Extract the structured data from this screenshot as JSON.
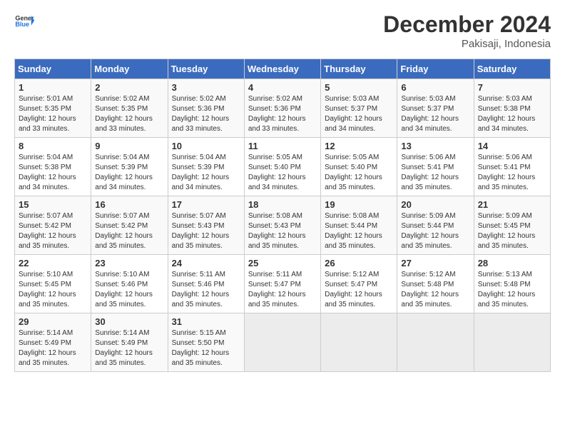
{
  "header": {
    "logo_line1": "General",
    "logo_line2": "Blue",
    "month_title": "December 2024",
    "location": "Pakisaji, Indonesia"
  },
  "days_of_week": [
    "Sunday",
    "Monday",
    "Tuesday",
    "Wednesday",
    "Thursday",
    "Friday",
    "Saturday"
  ],
  "weeks": [
    [
      {
        "num": "1",
        "rise": "5:01 AM",
        "set": "5:35 PM",
        "daylight": "12 hours and 33 minutes."
      },
      {
        "num": "2",
        "rise": "5:02 AM",
        "set": "5:35 PM",
        "daylight": "12 hours and 33 minutes."
      },
      {
        "num": "3",
        "rise": "5:02 AM",
        "set": "5:36 PM",
        "daylight": "12 hours and 33 minutes."
      },
      {
        "num": "4",
        "rise": "5:02 AM",
        "set": "5:36 PM",
        "daylight": "12 hours and 33 minutes."
      },
      {
        "num": "5",
        "rise": "5:03 AM",
        "set": "5:37 PM",
        "daylight": "12 hours and 34 minutes."
      },
      {
        "num": "6",
        "rise": "5:03 AM",
        "set": "5:37 PM",
        "daylight": "12 hours and 34 minutes."
      },
      {
        "num": "7",
        "rise": "5:03 AM",
        "set": "5:38 PM",
        "daylight": "12 hours and 34 minutes."
      }
    ],
    [
      {
        "num": "8",
        "rise": "5:04 AM",
        "set": "5:38 PM",
        "daylight": "12 hours and 34 minutes."
      },
      {
        "num": "9",
        "rise": "5:04 AM",
        "set": "5:39 PM",
        "daylight": "12 hours and 34 minutes."
      },
      {
        "num": "10",
        "rise": "5:04 AM",
        "set": "5:39 PM",
        "daylight": "12 hours and 34 minutes."
      },
      {
        "num": "11",
        "rise": "5:05 AM",
        "set": "5:40 PM",
        "daylight": "12 hours and 34 minutes."
      },
      {
        "num": "12",
        "rise": "5:05 AM",
        "set": "5:40 PM",
        "daylight": "12 hours and 35 minutes."
      },
      {
        "num": "13",
        "rise": "5:06 AM",
        "set": "5:41 PM",
        "daylight": "12 hours and 35 minutes."
      },
      {
        "num": "14",
        "rise": "5:06 AM",
        "set": "5:41 PM",
        "daylight": "12 hours and 35 minutes."
      }
    ],
    [
      {
        "num": "15",
        "rise": "5:07 AM",
        "set": "5:42 PM",
        "daylight": "12 hours and 35 minutes."
      },
      {
        "num": "16",
        "rise": "5:07 AM",
        "set": "5:42 PM",
        "daylight": "12 hours and 35 minutes."
      },
      {
        "num": "17",
        "rise": "5:07 AM",
        "set": "5:43 PM",
        "daylight": "12 hours and 35 minutes."
      },
      {
        "num": "18",
        "rise": "5:08 AM",
        "set": "5:43 PM",
        "daylight": "12 hours and 35 minutes."
      },
      {
        "num": "19",
        "rise": "5:08 AM",
        "set": "5:44 PM",
        "daylight": "12 hours and 35 minutes."
      },
      {
        "num": "20",
        "rise": "5:09 AM",
        "set": "5:44 PM",
        "daylight": "12 hours and 35 minutes."
      },
      {
        "num": "21",
        "rise": "5:09 AM",
        "set": "5:45 PM",
        "daylight": "12 hours and 35 minutes."
      }
    ],
    [
      {
        "num": "22",
        "rise": "5:10 AM",
        "set": "5:45 PM",
        "daylight": "12 hours and 35 minutes."
      },
      {
        "num": "23",
        "rise": "5:10 AM",
        "set": "5:46 PM",
        "daylight": "12 hours and 35 minutes."
      },
      {
        "num": "24",
        "rise": "5:11 AM",
        "set": "5:46 PM",
        "daylight": "12 hours and 35 minutes."
      },
      {
        "num": "25",
        "rise": "5:11 AM",
        "set": "5:47 PM",
        "daylight": "12 hours and 35 minutes."
      },
      {
        "num": "26",
        "rise": "5:12 AM",
        "set": "5:47 PM",
        "daylight": "12 hours and 35 minutes."
      },
      {
        "num": "27",
        "rise": "5:12 AM",
        "set": "5:48 PM",
        "daylight": "12 hours and 35 minutes."
      },
      {
        "num": "28",
        "rise": "5:13 AM",
        "set": "5:48 PM",
        "daylight": "12 hours and 35 minutes."
      }
    ],
    [
      {
        "num": "29",
        "rise": "5:14 AM",
        "set": "5:49 PM",
        "daylight": "12 hours and 35 minutes."
      },
      {
        "num": "30",
        "rise": "5:14 AM",
        "set": "5:49 PM",
        "daylight": "12 hours and 35 minutes."
      },
      {
        "num": "31",
        "rise": "5:15 AM",
        "set": "5:50 PM",
        "daylight": "12 hours and 35 minutes."
      },
      null,
      null,
      null,
      null
    ]
  ],
  "labels": {
    "sunrise": "Sunrise:",
    "sunset": "Sunset:",
    "daylight": "Daylight:"
  }
}
